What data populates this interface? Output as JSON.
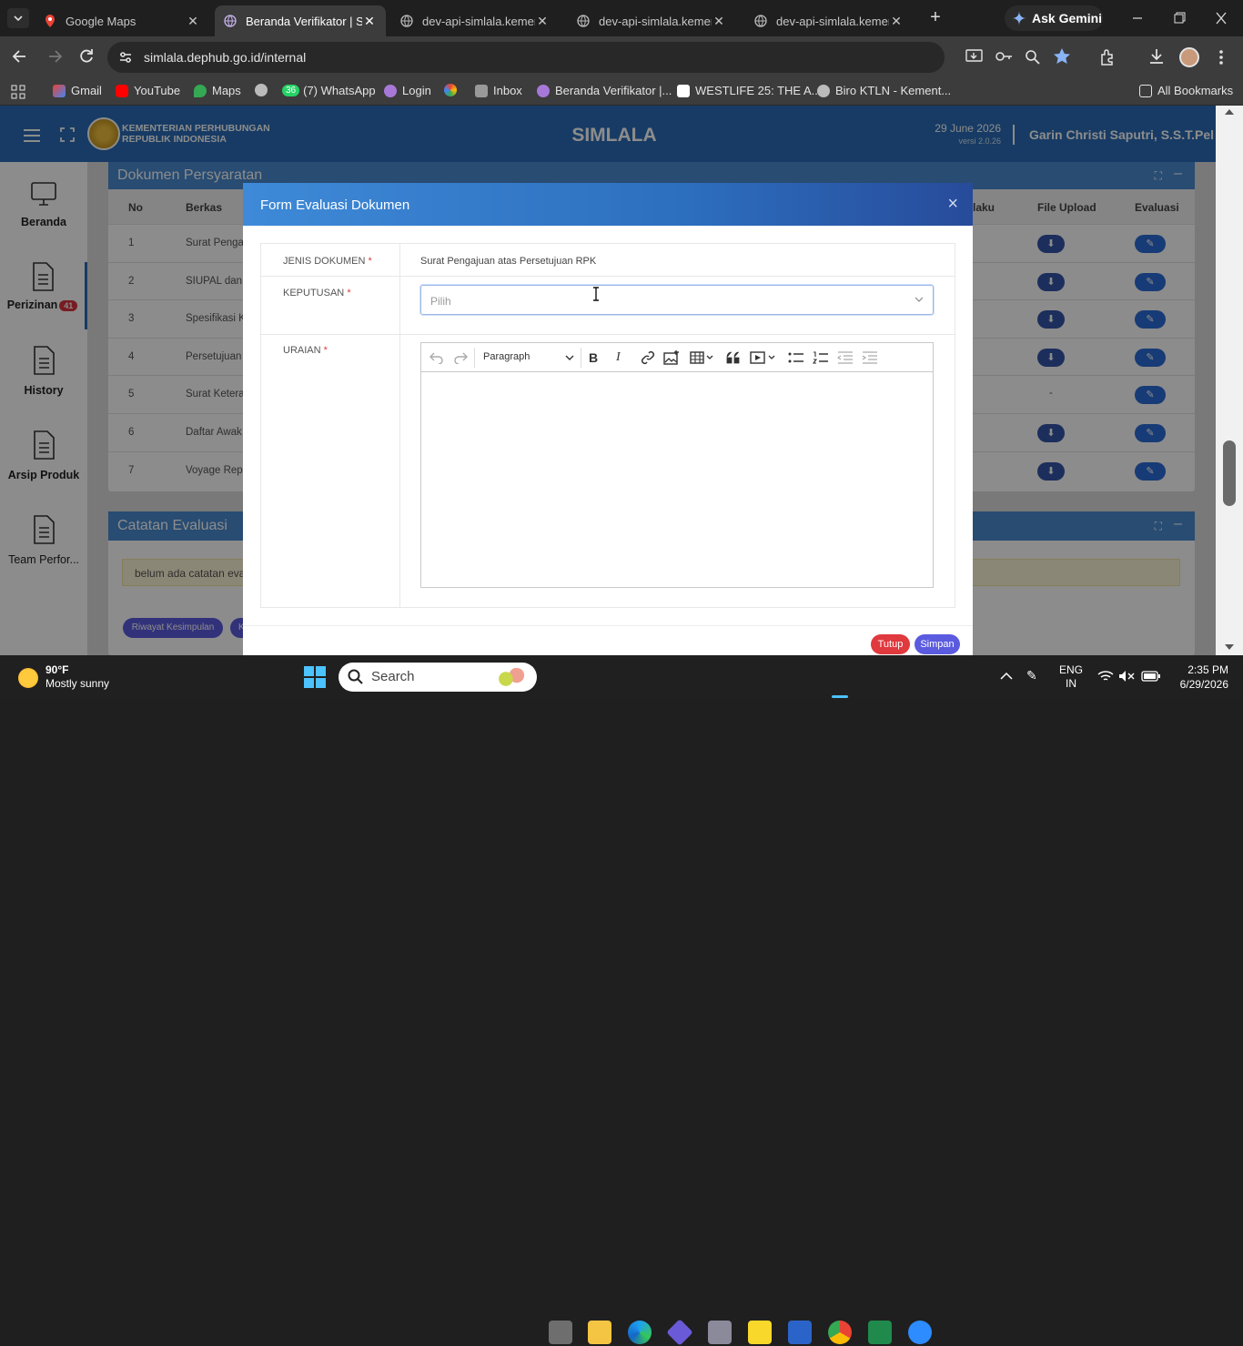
{
  "browser": {
    "tabs": [
      {
        "title": "Google Maps"
      },
      {
        "title": "Beranda Verifikator | Si"
      },
      {
        "title": "dev-api-simlala.kemenh"
      },
      {
        "title": "dev-api-simlala.kemenh"
      },
      {
        "title": "dev-api-simlala.kemenh"
      }
    ],
    "ask_gemini": "Ask Gemini",
    "url": "simlala.dephub.go.id/internal",
    "bookmarks": [
      "Gmail",
      "YouTube",
      "Maps",
      "(7) WhatsApp",
      "Login",
      "Inbox",
      "Beranda Verifikator |...",
      "WESTLIFE 25: THE A...",
      "Biro KTLN - Kement..."
    ],
    "whatsapp_badge": "36",
    "all_bookmarks": "All Bookmarks"
  },
  "app": {
    "org_line1": "KEMENTERIAN PERHUBUNGAN",
    "org_line2": "REPUBLIK INDONESIA",
    "title": "SIMLALA",
    "date": "29 June 2026",
    "version": "versi 2.0.26",
    "user": "Garin Christi Saputri, S.S.T.Pel"
  },
  "sidebar": {
    "items": [
      {
        "label": "Beranda"
      },
      {
        "label": "Perizinan",
        "badge": "41"
      },
      {
        "label": "History"
      },
      {
        "label": "Arsip Produk"
      },
      {
        "label": "Team Perfor..."
      }
    ]
  },
  "doc_card": {
    "title": "Dokumen Persyaratan",
    "columns": [
      "No",
      "Berkas",
      "laku",
      "File Upload",
      "Evaluasi"
    ],
    "rows": [
      {
        "no": "1",
        "berkas": "Surat Pengaj",
        "upload": true
      },
      {
        "no": "2",
        "berkas": "SIUPAL dan E",
        "upload": true
      },
      {
        "no": "3",
        "berkas": "Spesifikasi Ka",
        "upload": true
      },
      {
        "no": "4",
        "berkas": "Persetujuan S",
        "upload": true
      },
      {
        "no": "5",
        "berkas": "Surat Keteran",
        "upload": false
      },
      {
        "no": "6",
        "berkas": "Daftar Awak",
        "upload": true
      },
      {
        "no": "7",
        "berkas": "Voyage Repo",
        "upload": true
      }
    ],
    "no_upload_mark": "-"
  },
  "notes_card": {
    "title": "Catatan Evaluasi",
    "empty_note": "belum ada catatan evalu",
    "btn_history": "Riwayat Kesimpulan",
    "btn_partial": "K"
  },
  "modal": {
    "title": "Form Evaluasi Dokumen",
    "close": "×",
    "jenis_label": "JENIS DOKUMEN",
    "jenis_value": "Surat Pengajuan atas Persetujuan RPK",
    "keputusan_label": "KEPUTUSAN",
    "keputusan_placeholder": "Pilih",
    "uraian_label": "URAIAN",
    "required_mark": "*",
    "editor_block_format": "Paragraph",
    "btn_close": "Tutup",
    "btn_save": "Simpan"
  },
  "taskbar": {
    "weather_temp": "90°F",
    "weather_desc": "Mostly sunny",
    "search_placeholder": "Search",
    "lang1": "ENG",
    "lang2": "IN",
    "time": "2:35 PM",
    "date": "6/29/2026"
  },
  "colors": {
    "primary": "#2a6cb6",
    "modal_header": "#3e8ad8",
    "danger": "#e0393e",
    "purple": "#5b5be0",
    "badge_red": "#d9363e"
  }
}
